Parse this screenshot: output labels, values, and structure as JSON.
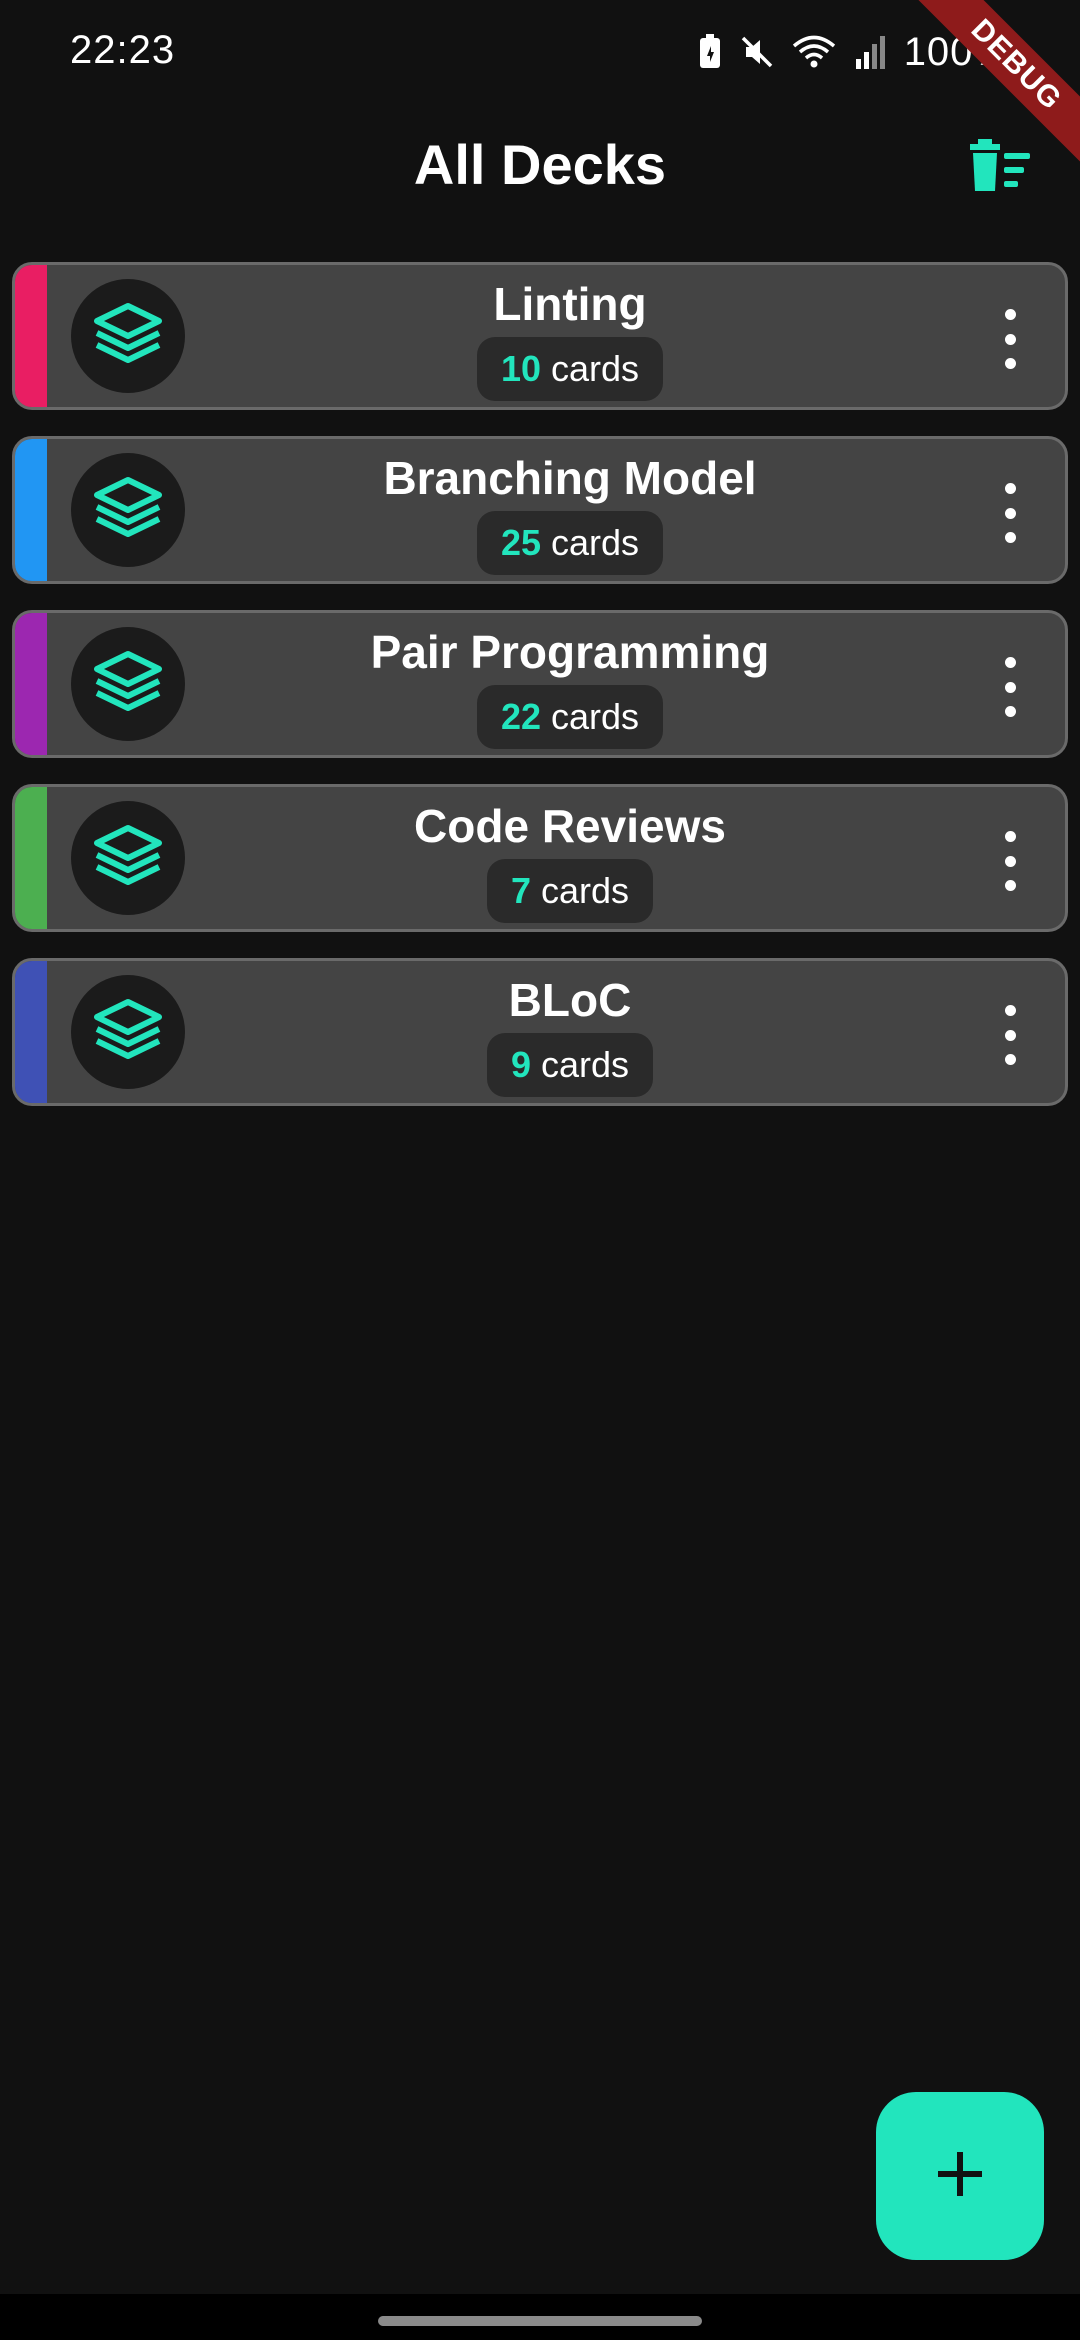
{
  "status_bar": {
    "time": "22:23",
    "battery_text": "100%",
    "icons": [
      "battery-saver-icon",
      "mute-icon",
      "wifi-icon",
      "signal-icon"
    ]
  },
  "debug_banner": {
    "label": "DEBUG"
  },
  "header": {
    "title": "All Decks",
    "action_icon": "clear-all-icon"
  },
  "colors": {
    "accent": "#22e5bd",
    "background": "#111111",
    "card": "#444444"
  },
  "decks": [
    {
      "title": "Linting",
      "count": "10",
      "count_suffix": "cards",
      "accent_color": "#e91e63",
      "icon": "layers-icon"
    },
    {
      "title": "Branching Model",
      "count": "25",
      "count_suffix": "cards",
      "accent_color": "#2196f3",
      "icon": "layers-icon"
    },
    {
      "title": "Pair Programming",
      "count": "22",
      "count_suffix": "cards",
      "accent_color": "#9c27b0",
      "icon": "layers-icon"
    },
    {
      "title": "Code Reviews",
      "count": "7",
      "count_suffix": "cards",
      "accent_color": "#4caf50",
      "icon": "layers-icon"
    },
    {
      "title": "BLoC",
      "count": "9",
      "count_suffix": "cards",
      "accent_color": "#3f51b5",
      "icon": "layers-icon"
    }
  ],
  "fab": {
    "icon": "plus-icon"
  }
}
